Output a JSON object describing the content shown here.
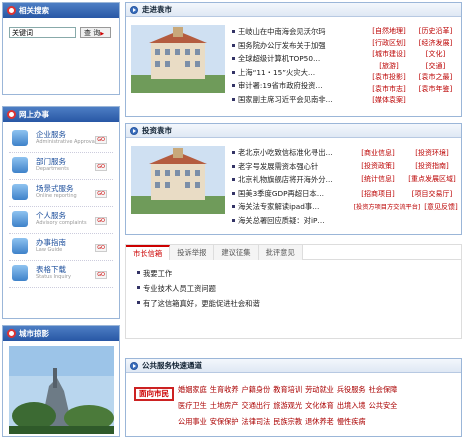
{
  "side": {
    "search_title": "相关搜索",
    "search_value": "关键词",
    "search_btn": "查 询",
    "online_title": "网上办事",
    "go": "GO",
    "services": [
      {
        "label": "企业服务",
        "sub": "Administrative Approval"
      },
      {
        "label": "部门服务",
        "sub": "Departments"
      },
      {
        "label": "场景式服务",
        "sub": "Online reporting"
      },
      {
        "label": "个人服务",
        "sub": "Advisory complaints"
      },
      {
        "label": "办事指南",
        "sub": "Law Guide"
      },
      {
        "label": "表格下载",
        "sub": "Status Inquiry"
      }
    ],
    "photo_title": "城市掠影"
  },
  "sec1": {
    "title": "走进袁市",
    "news": [
      {
        "t": "王岐山在中南海会见沃尔玛",
        "m": ""
      },
      {
        "t": "国务院办公厅发布关于加强",
        "m": "…"
      },
      {
        "t": "全球超级计算机TOP50…",
        "m": "…"
      },
      {
        "t": "上海“11・15”火灾大…",
        "m": ""
      },
      {
        "t": "审计署:19省市政府投资…",
        "m": ""
      },
      {
        "t": "国家副主席习近平会见南非…",
        "m": ""
      }
    ],
    "tags": [
      [
        "[自然地理]",
        "[历史沿革]"
      ],
      [
        "[行政区划]",
        "[经济发展]"
      ],
      [
        "[城市建设]",
        "[文化]"
      ],
      [
        "[旅游]",
        "[交通]"
      ],
      [
        "[袁市投影]",
        "[袁市之最]"
      ],
      [
        "[袁市市志]",
        "[袁市年鉴]"
      ],
      [
        "[媒体袁案]",
        ""
      ]
    ]
  },
  "sec2": {
    "title": "投资袁市",
    "news": [
      {
        "t": "老北京小吃致信标准化寻出…",
        "m": ""
      },
      {
        "t": "老字号发展需资本强心针",
        "m": ""
      },
      {
        "t": "北京礼物旗舰店将开海外分…",
        "m": ""
      },
      {
        "t": "国美3季度GDP再超日本…",
        "m": ""
      },
      {
        "t": "海关法专家解读ipad事…",
        "m": ""
      },
      {
        "t": "海关总署回应质疑：对iP…",
        "m": ""
      }
    ],
    "tags": [
      [
        "[商业信息]",
        "[投资环境]"
      ],
      [
        "[投资政策]",
        "[投资指南]"
      ],
      [
        "[统计信息]",
        "[重点发展区域]"
      ],
      [
        "[招商项目]",
        "[项目交易厅]"
      ],
      [
        "[投资方项目方交流平台]",
        "[意见反馈]"
      ]
    ]
  },
  "tabs": [
    "市长信箱",
    "投诉举报",
    "建议征集",
    "批评意见"
  ],
  "mailbox": [
    "我要工作",
    "专业技术人员工资问题",
    "有了这信箱真好，更能促进社会和谐"
  ],
  "svc": {
    "title": "公共服务快速通道",
    "badge": "面向市民",
    "rows": [
      [
        "婚姻家庭",
        "生育收养",
        "户籍身份",
        "教育培训",
        "劳动就业",
        "兵役服务",
        "社会保障"
      ],
      [
        "医疗卫生",
        "土地房产",
        "交通出行",
        "旅游观光",
        "文化体育",
        "出境入境",
        "公共安全"
      ],
      [
        "公用事业",
        "安保保护",
        "法律司法",
        "民族宗教",
        "退休养老",
        "慢性疾病"
      ]
    ]
  }
}
